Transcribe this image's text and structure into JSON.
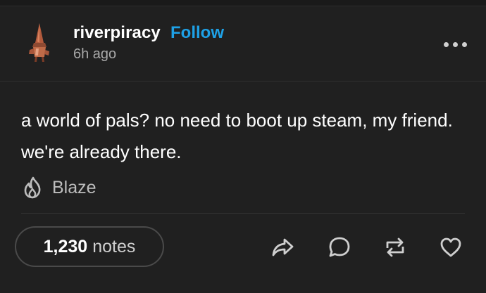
{
  "post": {
    "username": "riverpiracy",
    "follow_label": "Follow",
    "timestamp": "6h ago",
    "body": "a world of pals? no need to boot up steam, my friend. we're already there.",
    "blaze_label": "Blaze",
    "notes_count": "1,230",
    "notes_label": "notes"
  },
  "icons": {
    "more": "more-options-icon",
    "blaze": "flame-icon",
    "share": "share-arrow-icon",
    "reply": "speech-bubble-icon",
    "reblog": "reblog-icon",
    "like": "heart-icon"
  },
  "colors": {
    "background": "#202020",
    "accent": "#1ea1e6",
    "text": "#ffffff",
    "muted": "#a9a9a9"
  }
}
